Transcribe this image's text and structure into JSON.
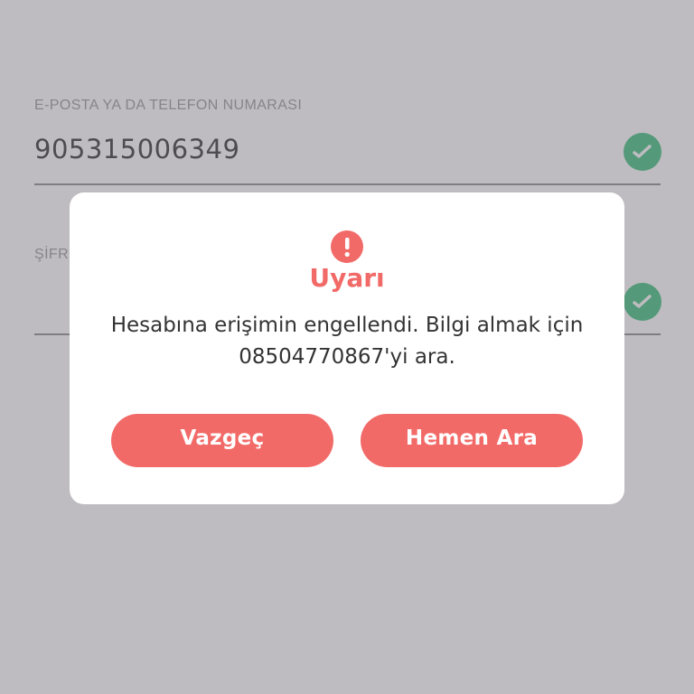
{
  "form": {
    "email_label": "E-POSTA YA DA TELEFON NUMARASI",
    "email_value": "905315006349",
    "password_label": "ŞİFRE"
  },
  "dialog": {
    "title": "Uyarı",
    "message": "Hesabına erişimin engellendi. Bilgi almak için 08504770867'yi ara.",
    "cancel_label": "Vazgeç",
    "call_label": "Hemen Ara"
  },
  "colors": {
    "accent": "#f26a68",
    "success": "#3fbf7f",
    "overlay": "#bcbbc0",
    "text": "#333333"
  },
  "icons": {
    "field_status": "check-icon",
    "dialog_alert": "exclamation-icon"
  }
}
